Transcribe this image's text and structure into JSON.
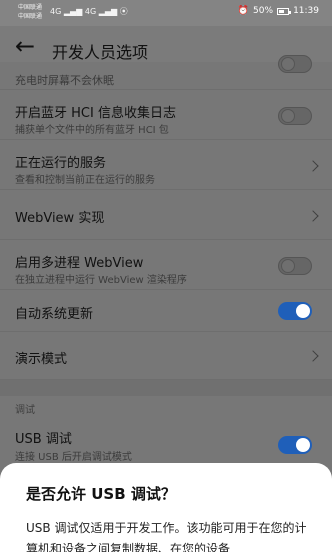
{
  "status_bar": {
    "carrier_1": "中国联通",
    "carrier_2": "中国联通",
    "network_1": "4G",
    "network_2": "4G",
    "alarm_icon": "alarm-icon",
    "battery": "50%",
    "time": "11:39"
  },
  "header": {
    "title": "开发人员选项",
    "back_icon": "arrow-left-icon"
  },
  "settings": {
    "partial_item_title": "充电时屏幕不会休眠",
    "bt_hci": {
      "title": "开启蓝牙 HCI 信息收集日志",
      "subtitle": "捕获单个文件中的所有蓝牙 HCI 包",
      "enabled": false
    },
    "running_services": {
      "title": "正在运行的服务",
      "subtitle": "查看和控制当前正在运行的服务"
    },
    "webview_impl": {
      "title": "WebView 实现"
    },
    "multi_webview": {
      "title": "启用多进程 WebView",
      "subtitle": "在独立进程中运行 WebView 渲染程序",
      "enabled": false
    },
    "auto_update": {
      "title": "自动系统更新",
      "enabled": true
    },
    "demo_mode": {
      "title": "演示模式"
    },
    "debug_section_label": "调试",
    "usb_debug": {
      "title": "USB 调试",
      "subtitle": "连接 USB 后开启调试模式",
      "enabled": true
    }
  },
  "dialog": {
    "title": "是否允许 USB 调试？",
    "body": "USB 调试仅适用于开发工作。该功能可用于在您的计算机和设备之间复制数据、在您的设备"
  }
}
